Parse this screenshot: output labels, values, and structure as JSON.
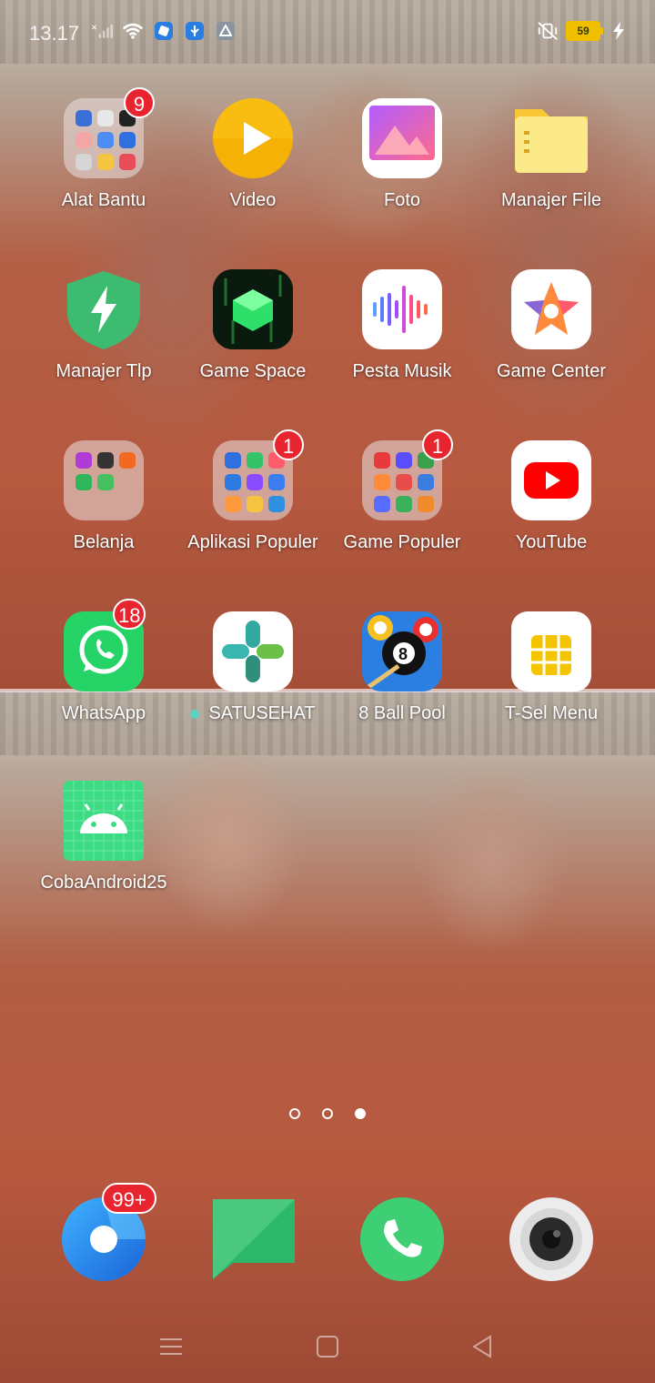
{
  "status_bar": {
    "time": "13.17",
    "battery_level": "59",
    "icons": [
      "signal-x-icon",
      "wifi-icon",
      "app-notif-icon",
      "usb-icon",
      "drive-icon",
      "mute-vibrate-icon",
      "battery-icon",
      "charging-icon"
    ]
  },
  "apps": [
    {
      "label": "Alat Bantu",
      "badge": "9",
      "type": "folder"
    },
    {
      "label": "Video",
      "badge": "",
      "type": "app"
    },
    {
      "label": "Foto",
      "badge": "",
      "type": "app"
    },
    {
      "label": "Manajer File",
      "badge": "",
      "type": "app"
    },
    {
      "label": "Manajer Tlp",
      "badge": "",
      "type": "app"
    },
    {
      "label": "Game Space",
      "badge": "",
      "type": "app"
    },
    {
      "label": "Pesta Musik",
      "badge": "",
      "type": "app"
    },
    {
      "label": "Game Center",
      "badge": "",
      "type": "app"
    },
    {
      "label": "Belanja",
      "badge": "",
      "type": "folder"
    },
    {
      "label": "Aplikasi Populer",
      "badge": "1",
      "type": "folder"
    },
    {
      "label": "Game Populer",
      "badge": "1",
      "type": "folder"
    },
    {
      "label": "YouTube",
      "badge": "",
      "type": "app"
    },
    {
      "label": "WhatsApp",
      "badge": "18",
      "type": "app"
    },
    {
      "label": "SATUSEHAT",
      "badge": "",
      "type": "app",
      "new_indicator": true
    },
    {
      "label": "8 Ball Pool",
      "badge": "",
      "type": "app"
    },
    {
      "label": "T-Sel Menu",
      "badge": "",
      "type": "app"
    },
    {
      "label": "CobaAndroid25",
      "badge": "",
      "type": "app"
    }
  ],
  "page_indicator": {
    "pages": 3,
    "current": 3
  },
  "dock": [
    {
      "name": "browser",
      "badge": "99+"
    },
    {
      "name": "messages",
      "badge": ""
    },
    {
      "name": "phone",
      "badge": ""
    },
    {
      "name": "camera",
      "badge": ""
    }
  ],
  "navigation": [
    "recents-button",
    "home-button",
    "back-button"
  ],
  "colors": {
    "badge": "#e8242f",
    "whatsapp": "#25d366",
    "youtube": "#ff0000",
    "game_space": "#0d1a10"
  }
}
